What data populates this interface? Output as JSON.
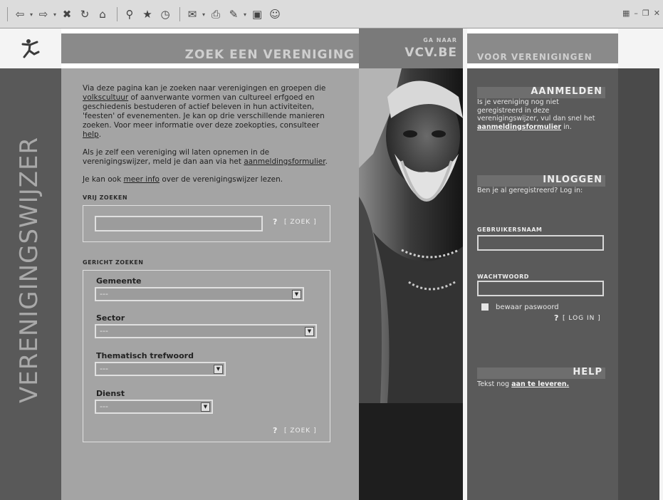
{
  "toolbar": {
    "buttons": [
      "back-icon",
      "forward-icon",
      "stop-icon",
      "refresh-icon",
      "home-icon",
      "search-icon",
      "favorites-icon",
      "history-icon",
      "mail-icon",
      "print-icon",
      "edit-icon",
      "discuss-icon",
      "messenger-icon"
    ]
  },
  "header": {
    "title": "ZOEK EEN VERENIGING",
    "vcv_small": "GA NAAR",
    "vcv_big": "VCV.BE",
    "side_title": "VOOR VERENIGINGEN"
  },
  "sidebar_vertical": "VERENIGINGSWIJZER",
  "intro": {
    "p1_a": "Via deze pagina kan je zoeken naar verenigingen en groepen die ",
    "p1_link1": "volkscultuur",
    "p1_b": " of aanverwante vormen van cultureel erfgoed en geschiedenis bestuderen of actief beleven in hun activiteiten, 'feesten' of evenementen. Je kan op drie verschillende manieren zoeken. Voor meer informatie over deze zoekopties, consulteer ",
    "p1_link2": "help",
    "p1_c": ".",
    "p2_a": "Als je zelf een vereniging wil laten opnemen in de verenigingswijzer, meld je dan aan via het ",
    "p2_link": "aanmeldingsformulier",
    "p2_b": ".",
    "p3_a": "Je kan ook ",
    "p3_link": "meer info",
    "p3_b": " over de verenigingswijzer lezen."
  },
  "free_search": {
    "label": "VRIJ ZOEKEN",
    "value": "",
    "help": "?",
    "button": "[ ZOEK ]"
  },
  "directed_search": {
    "label": "GERICHT ZOEKEN",
    "fields": [
      {
        "label": "Gemeente",
        "value": "---"
      },
      {
        "label": "Sector",
        "value": "---"
      },
      {
        "label": "Thematisch trefwoord",
        "value": "---"
      },
      {
        "label": "Dienst",
        "value": "---"
      }
    ],
    "help": "?",
    "button": "[ ZOEK ]"
  },
  "aanmelden": {
    "title": "AANMELDEN",
    "text_a": "Is je vereniging nog niet geregistreerd in deze verenigingswijzer, vul dan snel het ",
    "link": "aanmeldingsformulier",
    "text_b": " in."
  },
  "inloggen": {
    "title": "INLOGGEN",
    "text": "Ben je al geregistreerd? Log in:",
    "user_label": "GEBRUIKERSNAAM",
    "user_value": "",
    "pass_label": "WACHTWOORD",
    "pass_value": "",
    "remember": "bewaar paswoord",
    "help": "?",
    "button": "[ LOG IN ]"
  },
  "help": {
    "title": "HELP",
    "text": "Tekst nog ",
    "link": "aan te leveren."
  }
}
